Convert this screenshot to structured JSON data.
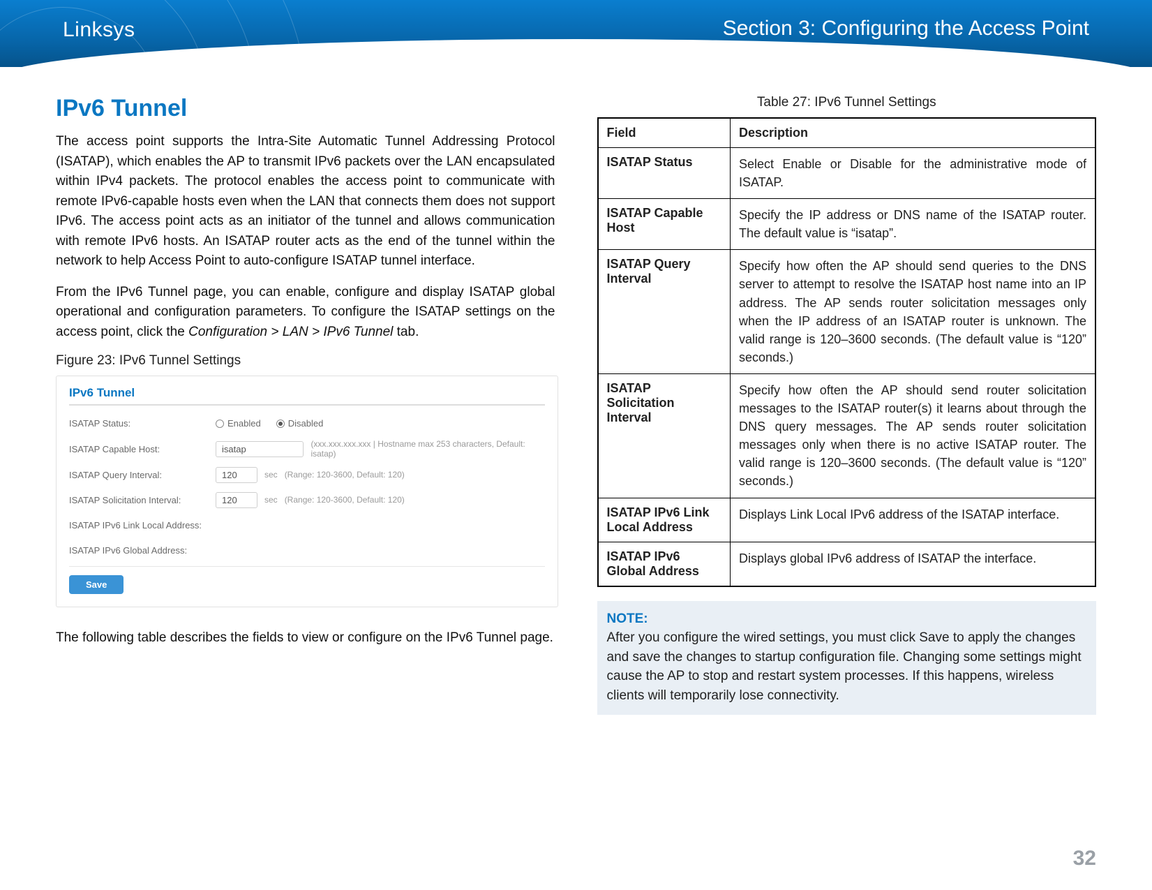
{
  "header": {
    "brand": "Linksys",
    "section": "Section 3:  Configuring the Access Point"
  },
  "left": {
    "heading": "IPv6 Tunnel",
    "para1": "The access point supports the Intra-Site Automatic Tunnel Addressing Protocol (ISATAP), which enables the AP to transmit IPv6 packets over the LAN encapsulated within IPv4 packets. The protocol enables the access point to communicate with remote IPv6-capable hosts even when the LAN that connects them does not support IPv6. The access point acts as an initiator of the tunnel and allows communication with remote IPv6 hosts. An ISATAP router acts as the end of the tunnel within the network to help Access Point to auto-configure ISATAP tunnel interface.",
    "para2_pre": "From the IPv6 Tunnel page, you can enable, configure and display ISATAP global operational and configuration parameters. To configure the ISATAP settings on the access point, click the ",
    "para2_italic": "Configuration > LAN > IPv6 Tunnel",
    "para2_post": " tab.",
    "figure_caption": "Figure 23: IPv6 Tunnel Settings",
    "shot": {
      "title": "IPv6 Tunnel",
      "rows": {
        "status_label": "ISATAP Status:",
        "enabled": "Enabled",
        "disabled": "Disabled",
        "host_label": "ISATAP Capable Host:",
        "host_value": "isatap",
        "host_hint": "(xxx.xxx.xxx.xxx | Hostname max 253 characters, Default: isatap)",
        "query_label": "ISATAP Query Interval:",
        "query_value": "120",
        "query_unit": "sec",
        "query_hint": "(Range: 120-3600, Default: 120)",
        "solic_label": "ISATAP Solicitation Interval:",
        "solic_value": "120",
        "solic_unit": "sec",
        "solic_hint": "(Range: 120-3600, Default: 120)",
        "link_local_label": "ISATAP IPv6 Link Local Address:",
        "global_label": "ISATAP IPv6 Global Address:"
      },
      "save": "Save"
    },
    "para3": "The following table describes the fields to view or configure on the IPv6 Tunnel page."
  },
  "right": {
    "table_caption": "Table 27: IPv6 Tunnel Settings",
    "head_field": "Field",
    "head_desc": "Description",
    "rows": [
      {
        "field": "ISATAP Status",
        "desc": "Select Enable or Disable for the administrative mode of ISATAP."
      },
      {
        "field": "ISATAP Capable Host",
        "desc": "Specify the IP address or DNS name of the ISATAP router. The default value is “isatap”."
      },
      {
        "field": "ISATAP Query Interval",
        "desc": "Specify how often the AP should send queries to the DNS server to attempt to resolve the ISATAP host name into an IP address. The AP sends router solicitation messages only when the IP address of an ISATAP router is unknown. The valid range is 120–3600 seconds. (The default value is “120” seconds.)"
      },
      {
        "field": "ISATAP Solicitation Interval",
        "desc": "Specify how often the AP should send router solicitation messages to the ISATAP router(s) it learns about through the DNS query messages. The AP sends router solicitation messages only when there is no active ISATAP router. The valid range is 120–3600 seconds. (The default value is “120” seconds.)"
      },
      {
        "field": "ISATAP IPv6  Link Local Address",
        "desc": "Displays Link Local IPv6 address of the ISATAP interface."
      },
      {
        "field": "ISATAP IPv6 Global Address",
        "desc": "Displays global IPv6 address of ISATAP the interface."
      }
    ],
    "note_label": "NOTE:",
    "note_body": "After you configure the wired settings, you must click Save to apply the changes and save the changes to startup configuration file. Changing some settings might cause the AP to stop and restart system processes. If this happens, wireless clients will temporarily lose connectivity."
  },
  "page_number": "32"
}
